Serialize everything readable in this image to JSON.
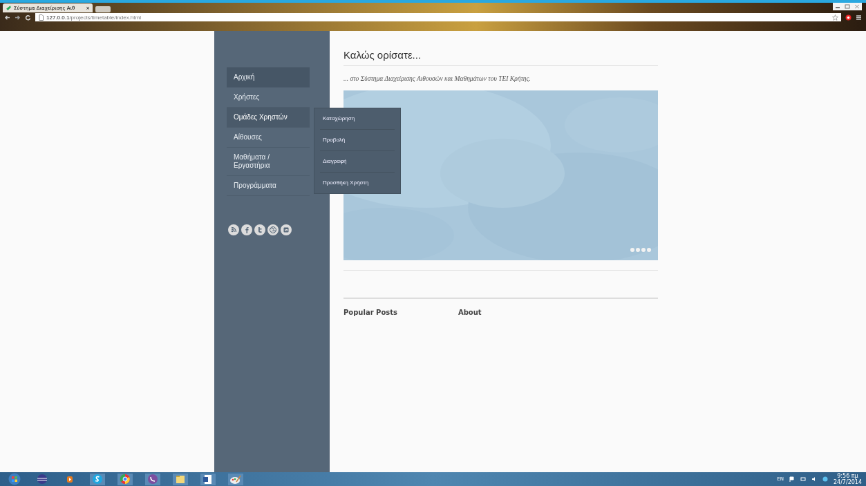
{
  "browser": {
    "tab_title": "Σύστημα Διαχείρισης Αιθ",
    "tab_close": "×",
    "url_host": "127.0.0.1",
    "url_path": "/projects/timetable/index.html"
  },
  "sidebar": {
    "menu": [
      {
        "label": "Αρχική",
        "selected": true,
        "expanded": false
      },
      {
        "label": "Χρήστες",
        "selected": false,
        "expanded": false
      },
      {
        "label": "Ομάδες Χρηστών",
        "selected": false,
        "expanded": true,
        "children": [
          {
            "label": "Καταχώρηση"
          },
          {
            "label": "Προβολή"
          },
          {
            "label": "Διαγραφή"
          },
          {
            "label": "Προσθήκη Χρήστη"
          }
        ]
      },
      {
        "label": "Αίθουσες",
        "selected": false,
        "expanded": false
      },
      {
        "label": "Μαθήματα / Εργαστήρια",
        "selected": false,
        "expanded": false
      },
      {
        "label": "Προγράμματα",
        "selected": false,
        "expanded": false
      }
    ],
    "social": [
      {
        "kind": "rss"
      },
      {
        "kind": "facebook"
      },
      {
        "kind": "twitter"
      },
      {
        "kind": "dribbble"
      },
      {
        "kind": "linkedin"
      }
    ]
  },
  "content": {
    "heading": "Καλώς ορίσατε...",
    "subtitle": "... στο Σύστημα Διαχείρισης Αιθουσών και Μαθημάτων του ΤΕΙ Κρήτης.",
    "footer_headings": [
      "Popular Posts",
      "About"
    ]
  },
  "taskbar": {
    "language": "EN",
    "time": "9:56 πμ",
    "date": "24/7/2014"
  }
}
